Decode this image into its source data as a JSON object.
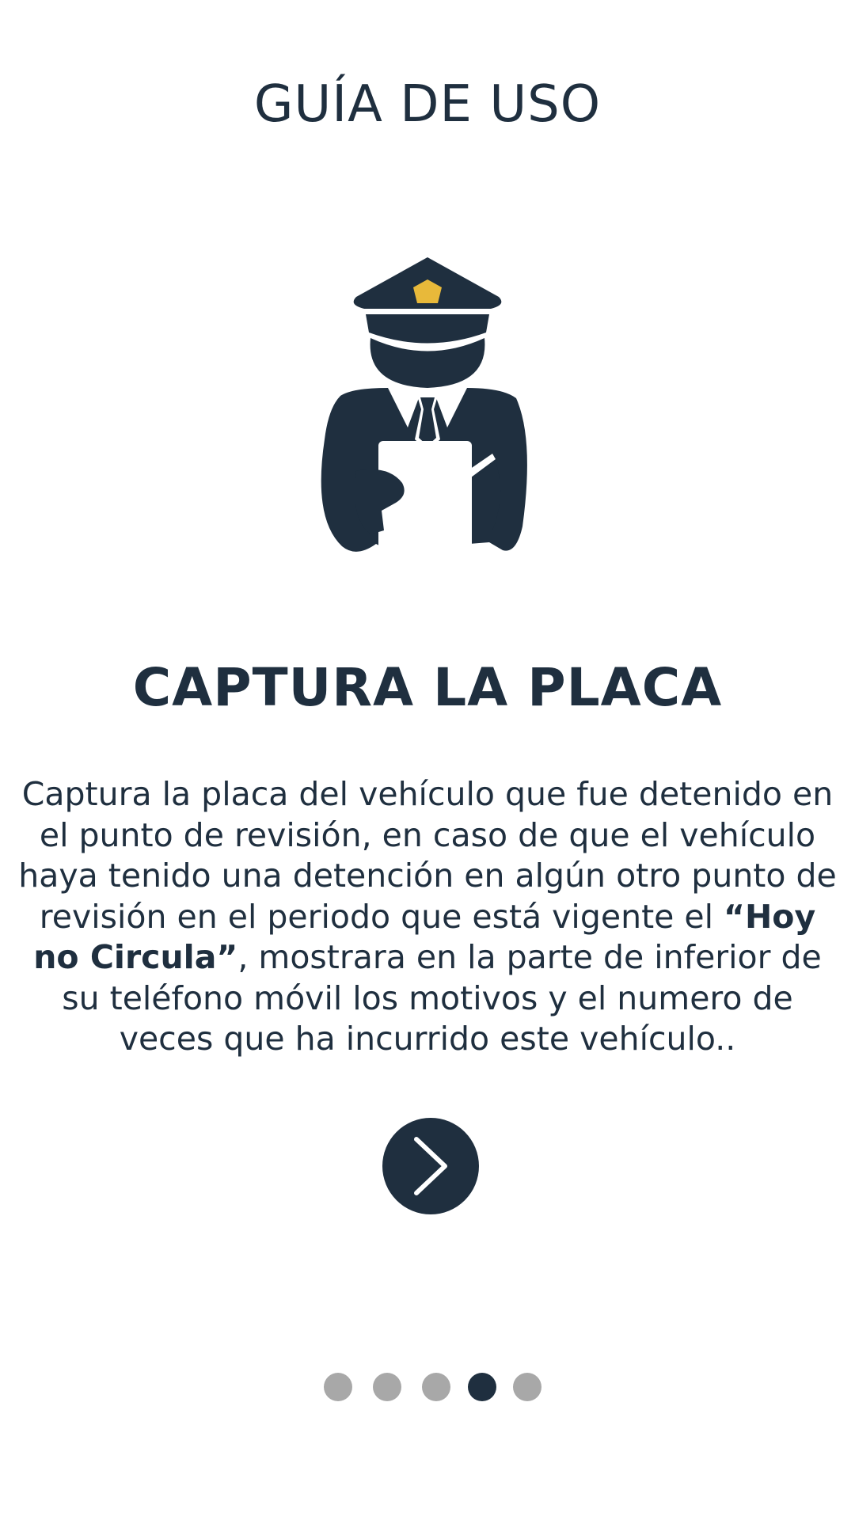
{
  "header": {
    "title": "GUÍA DE USO"
  },
  "illustration": {
    "icon": "police-officer-with-clipboard-icon",
    "badge_color": "#E8B93A",
    "figure_color": "#1F2F3F"
  },
  "step": {
    "title": "CAPTURA LA PLACA",
    "description_before": "Captura la placa del vehículo que fue detenido en el punto de revisión, en caso de que el vehículo haya tenido una detención en algún otro punto de revisión en el periodo que está vigente el ",
    "description_emphasis": "“Hoy no Circula”",
    "description_after": ", mostrara en la parte de inferior de su teléfono móvil los motivos y el numero de veces que ha incurrido este vehículo.."
  },
  "navigation": {
    "next_icon": "chevron-right-icon",
    "total_pages": 5,
    "current_page": 4
  },
  "colors": {
    "primary": "#1F2F3F",
    "inactive_dot": "#A8A8A8",
    "background": "#FFFFFF"
  }
}
